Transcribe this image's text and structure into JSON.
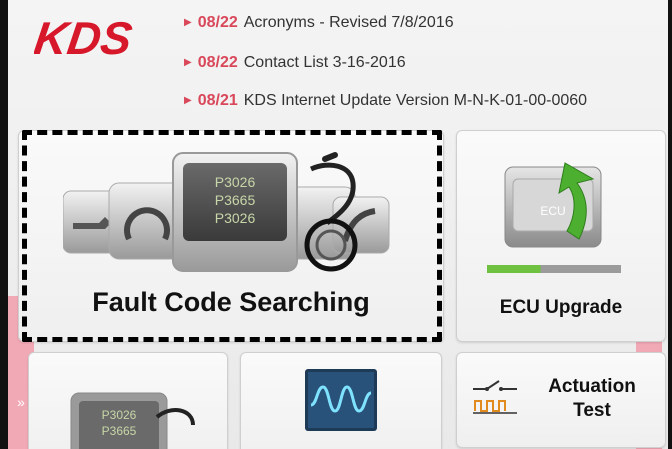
{
  "brand": {
    "logo_text": "KDS",
    "accent": "#d7182a"
  },
  "news": [
    {
      "date": "08/22",
      "text": "Acronyms - Revised 7/8/2016"
    },
    {
      "date": "08/22",
      "text": "Contact List 3-16-2016"
    },
    {
      "date": "08/21",
      "text": "KDS Internet Update Version M-N-K-01-00-0060"
    }
  ],
  "tiles": {
    "fault_code": {
      "label": "Fault Code Searching",
      "codes": [
        "P3026",
        "P3665",
        "P3026"
      ]
    },
    "ecu_upgrade": {
      "label": "ECU Upgrade",
      "chip_text": "ECU",
      "progress": 0.4
    },
    "bottom_left": {
      "codes": [
        "P3026",
        "P3665"
      ]
    },
    "actuation": {
      "label_line1": "Actuation",
      "label_line2": "Test"
    }
  },
  "nav": {
    "right_arrow": "»",
    "left_arrow": "«"
  },
  "colors": {
    "date_red": "#d9485a",
    "highlight_border": "#000000",
    "side_pink": "#f2a9b6",
    "progress_green": "#6fc23f"
  }
}
